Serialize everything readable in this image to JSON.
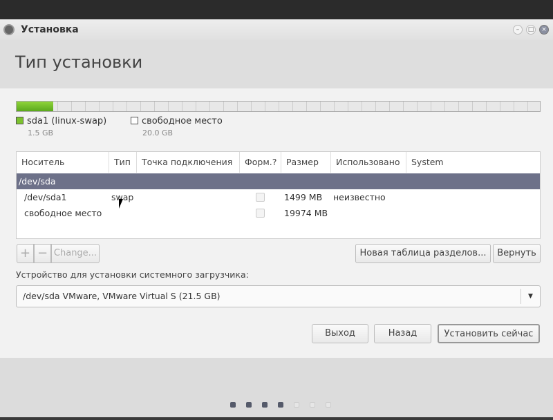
{
  "window": {
    "title": "Установка"
  },
  "header": {
    "title": "Тип установки"
  },
  "disk_bar": {
    "used_fraction": 0.07,
    "used_color": "#7cc22e"
  },
  "legend": [
    {
      "label": "sda1 (linux-swap)",
      "size": "1.5 GB",
      "color": "#7cc22e"
    },
    {
      "label": "свободное место",
      "size": "20.0 GB",
      "color": "#ffffff"
    }
  ],
  "table": {
    "columns": [
      "Носитель",
      "Тип",
      "Точка подключения",
      "Форм.?",
      "Размер",
      "Использовано",
      "System"
    ],
    "device": "/dev/sda",
    "rows": [
      {
        "device": "/dev/sda1",
        "type": "swap",
        "mount": "",
        "format": false,
        "size": "1499 MB",
        "used": "неизвестно",
        "system": ""
      },
      {
        "device": "свободное место",
        "type": "",
        "mount": "",
        "format": false,
        "size": "19974 MB",
        "used": "",
        "system": ""
      }
    ]
  },
  "toolbar": {
    "add": "+",
    "remove": "−",
    "change": "Change...",
    "new_table": "Новая таблица разделов...",
    "revert": "Вернуть"
  },
  "bootloader": {
    "label": "Устройство для установки системного загрузчика:",
    "value": "/dev/sda  VMware, VMware Virtual S (21.5 GB)"
  },
  "buttons": {
    "quit": "Выход",
    "back": "Назад",
    "install": "Установить сейчас"
  },
  "progress": {
    "current_step": 4,
    "total_steps": 7
  }
}
